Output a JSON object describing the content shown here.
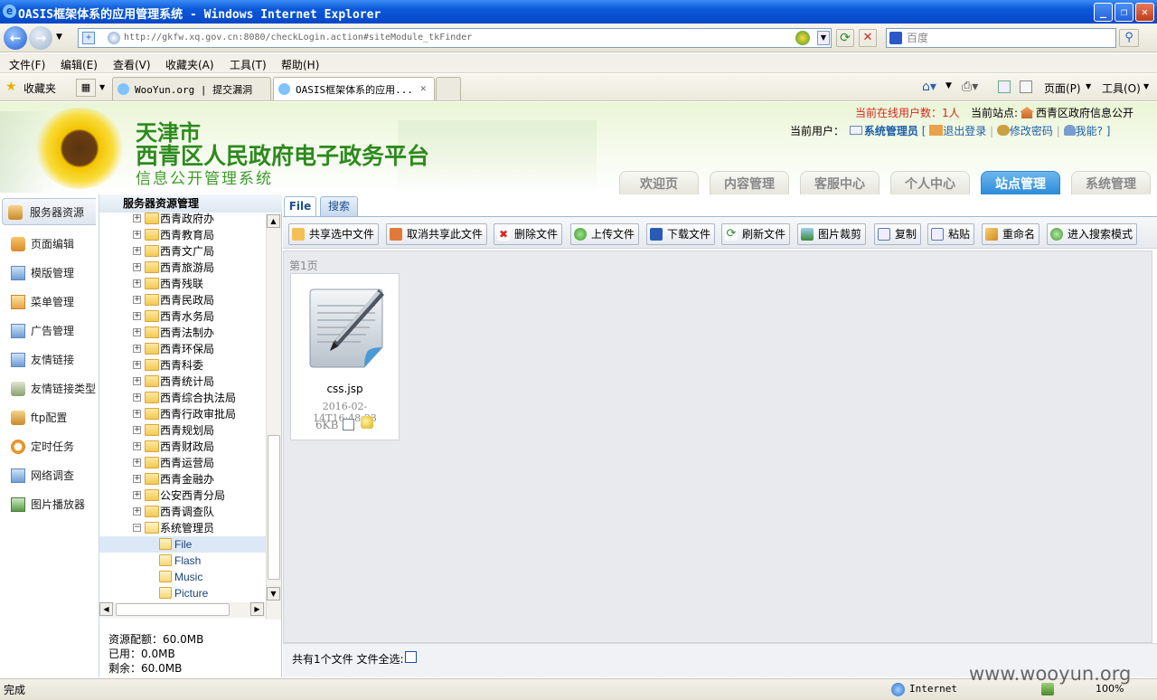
{
  "window": {
    "title": "OASIS框架体系的应用管理系统 - Windows Internet Explorer",
    "minimize": "_",
    "maximize": "❐",
    "close": "✕"
  },
  "browser": {
    "url": "http://gkfw.xq.gov.cn:8080/checkLogin.action#siteModule_tkFinder",
    "search_placeholder": "百度",
    "menu": [
      "文件(F)",
      "编辑(E)",
      "查看(V)",
      "收藏夹(A)",
      "工具(T)",
      "帮助(H)"
    ],
    "favorites_label": "收藏夹",
    "tabs": [
      {
        "label": "WooYun.org | 提交漏洞"
      },
      {
        "label": "OASIS框架体系的应用..."
      }
    ],
    "right_tools": {
      "page": "页面(P)",
      "tools": "工具(O)"
    }
  },
  "site": {
    "title_line1": "天津市",
    "title_line2": "西青区人民政府电子政务平台",
    "title_line3": "信息公开管理系统",
    "online_label": "当前在线用户数：",
    "online_count": "1人",
    "station_label": "当前站点:",
    "station_name": "西青区政府信息公开",
    "user_label": "当前用户：",
    "user_name": "系统管理员",
    "logout": "退出登录",
    "change_pwd": "修改密码",
    "help": "我能?",
    "nav": [
      {
        "label": "欢迎页"
      },
      {
        "label": "内容管理"
      },
      {
        "label": "客服中心"
      },
      {
        "label": "个人中心"
      },
      {
        "label": "站点管理"
      },
      {
        "label": "系统管理"
      }
    ]
  },
  "leftnav": [
    {
      "label": "服务器资源"
    },
    {
      "label": "页面编辑"
    },
    {
      "label": "模版管理"
    },
    {
      "label": "菜单管理"
    },
    {
      "label": "广告管理"
    },
    {
      "label": "友情链接"
    },
    {
      "label": "友情链接类型"
    },
    {
      "label": "ftp配置"
    },
    {
      "label": "定时任务"
    },
    {
      "label": "网络调查"
    },
    {
      "label": "图片播放器"
    }
  ],
  "tree": {
    "header": "服务器资源管理",
    "folders": [
      "西青政府办",
      "西青教育局",
      "西青文广局",
      "西青旅游局",
      "西青残联",
      "西青民政局",
      "西青水务局",
      "西青法制办",
      "西青环保局",
      "西青科委",
      "西青统计局",
      "西青综合执法局",
      "西青行政审批局",
      "西青规划局",
      "西青财政局",
      "西青运营局",
      "西青金融办",
      "公安西青分局",
      "西青调查队",
      "系统管理员"
    ],
    "subfolders": [
      "File",
      "Flash",
      "Music",
      "Picture"
    ]
  },
  "quota": {
    "total": "资源配额：60.0MB",
    "used": "已用：0.0MB",
    "remain": "剩余：60.0MB"
  },
  "main": {
    "tabs": [
      {
        "label": "File"
      },
      {
        "label": "搜索"
      }
    ],
    "toolbar": [
      "共享选中文件",
      "取消共享此文件",
      "删除文件",
      "上传文件",
      "下载文件",
      "刷新文件",
      "图片裁剪",
      "复制",
      "粘贴",
      "重命名",
      "进入搜索模式"
    ],
    "page_label": "第1页",
    "file": {
      "name": "css.jsp",
      "date": "2016-02-14T16:48:23",
      "size": "6KB"
    },
    "footer": "共有1个文件 文件全选:"
  },
  "status": {
    "left": "完成",
    "zone": "Internet",
    "zoom": "100%"
  },
  "watermark": "www.wooyun.org"
}
